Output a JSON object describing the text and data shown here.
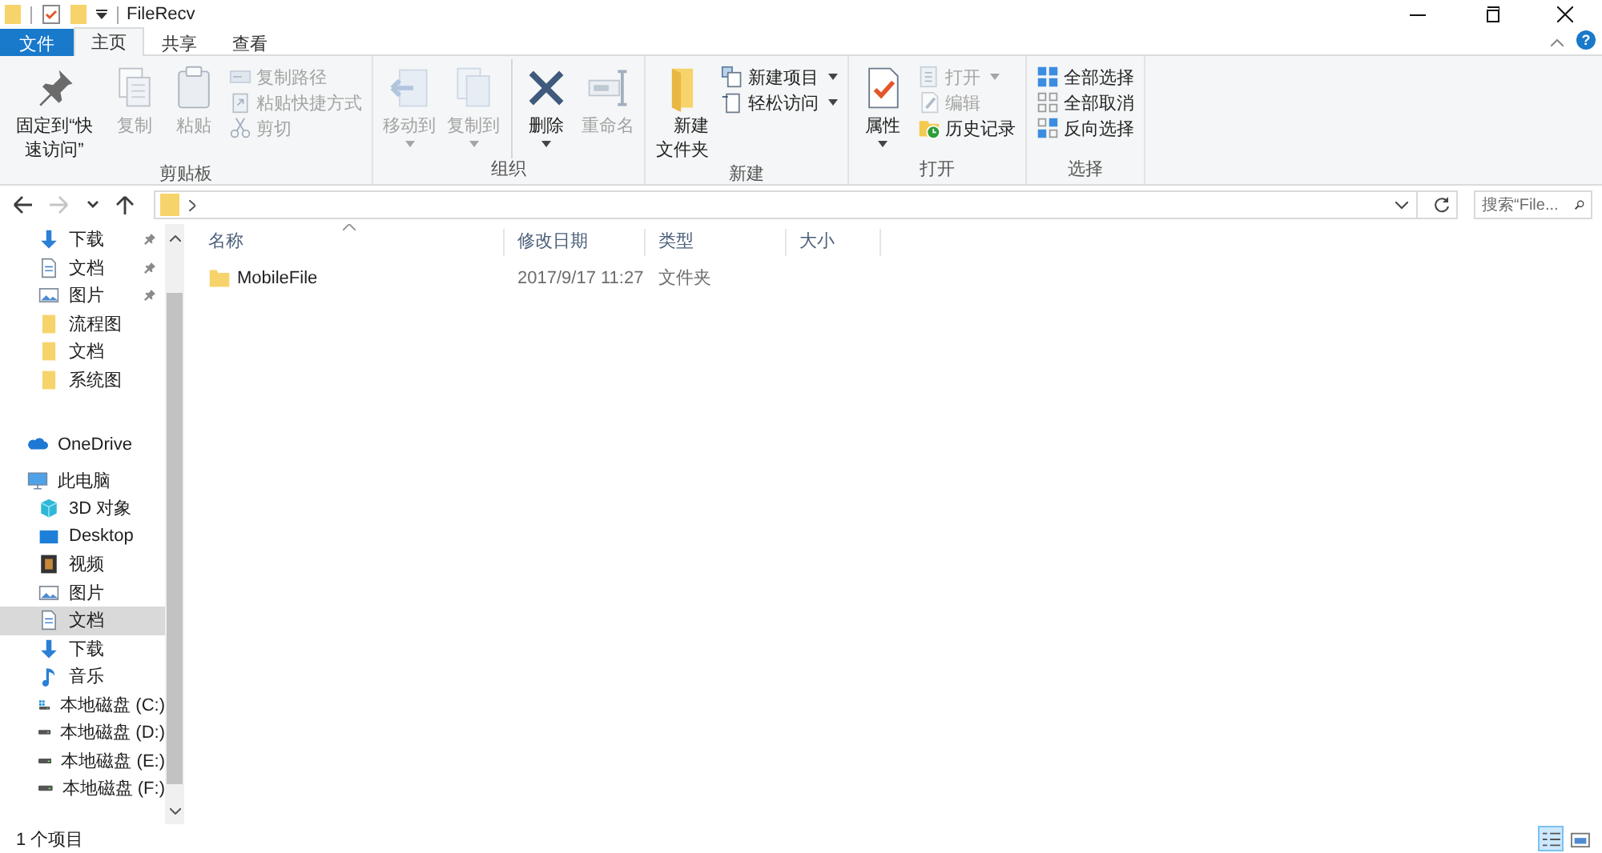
{
  "title_bar": {
    "title": "FileRecv"
  },
  "ribbon": {
    "tabs": [
      {
        "label": "文件",
        "kind": "file",
        "selected": false
      },
      {
        "label": "主页",
        "kind": "tab",
        "selected": true
      },
      {
        "label": "共享",
        "kind": "tab",
        "selected": false
      },
      {
        "label": "查看",
        "kind": "tab",
        "selected": false
      }
    ],
    "help": "?",
    "groups": [
      {
        "label": "剪贴板",
        "buttons": [
          {
            "label": "固定到“快速访问”",
            "kind": "pin",
            "disabled": false,
            "dropdown": false,
            "separator_before": false
          },
          {
            "label": "复制",
            "kind": "copy",
            "disabled": true,
            "dropdown": false,
            "separator_before": false
          },
          {
            "label": "粘贴",
            "kind": "paste",
            "disabled": true,
            "dropdown": false,
            "separator_before": false
          }
        ],
        "menu": [
          {
            "label": "复制路径",
            "kind": "copypath",
            "disabled": true,
            "dropdown": false
          },
          {
            "label": "粘贴快捷方式",
            "kind": "pasteshortcut",
            "disabled": true,
            "dropdown": false
          },
          {
            "label": "剪切",
            "kind": "cut",
            "disabled": true,
            "dropdown": false
          }
        ]
      },
      {
        "label": "组织",
        "buttons": [
          {
            "label": "移动到",
            "kind": "moveto",
            "disabled": true,
            "dropdown": true,
            "separator_before": false
          },
          {
            "label": "复制到",
            "kind": "copyto",
            "disabled": true,
            "dropdown": true,
            "separator_before": false
          },
          {
            "label": "删除",
            "kind": "delete",
            "disabled": false,
            "dropdown": true,
            "separator_before": true
          },
          {
            "label": "重命名",
            "kind": "rename",
            "disabled": true,
            "dropdown": false,
            "separator_before": false
          }
        ]
      },
      {
        "label": "新建",
        "buttons": [
          {
            "label": "新建文件夹",
            "kind": "newfolder",
            "disabled": false,
            "dropdown": false,
            "separator_before": false
          }
        ],
        "menu": [
          {
            "label": "新建项目",
            "kind": "newitem",
            "disabled": false,
            "dropdown": true
          },
          {
            "label": "轻松访问",
            "kind": "easyaccess",
            "disabled": false,
            "dropdown": true
          }
        ]
      },
      {
        "label": "打开",
        "buttons": [
          {
            "label": "属性",
            "kind": "properties",
            "disabled": false,
            "dropdown": true,
            "separator_before": false
          }
        ],
        "menu": [
          {
            "label": "打开",
            "kind": "open",
            "disabled": true,
            "dropdown": true
          },
          {
            "label": "编辑",
            "kind": "edit",
            "disabled": true,
            "dropdown": false
          },
          {
            "label": "历史记录",
            "kind": "history",
            "disabled": false,
            "dropdown": false
          }
        ]
      },
      {
        "label": "选择",
        "menu": [
          {
            "label": "全部选择",
            "kind": "selectall",
            "disabled": false,
            "dropdown": false
          },
          {
            "label": "全部取消",
            "kind": "selectnone",
            "disabled": false,
            "dropdown": false
          },
          {
            "label": "反向选择",
            "kind": "invert",
            "disabled": false,
            "dropdown": false
          }
        ]
      }
    ]
  },
  "address_bar": {
    "nav_buttons": [
      {
        "kind": "back",
        "disabled": false
      },
      {
        "kind": "forward",
        "disabled": true
      },
      {
        "kind": "recent",
        "disabled": false
      },
      {
        "kind": "up",
        "disabled": false
      }
    ],
    "search": {
      "placeholder": "搜索“File..."
    }
  },
  "nav_pane": {
    "quick_access": [
      {
        "label": "下载",
        "kind": "downloads",
        "pinned": true,
        "selected": false
      },
      {
        "label": "文档",
        "kind": "documents",
        "pinned": true,
        "selected": false
      },
      {
        "label": "图片",
        "kind": "pictures",
        "pinned": true,
        "selected": false
      },
      {
        "label": "流程图",
        "kind": "folder",
        "pinned": false,
        "selected": false
      },
      {
        "label": "文档",
        "kind": "folder",
        "pinned": false,
        "selected": false
      },
      {
        "label": "系统图",
        "kind": "folder",
        "pinned": false,
        "selected": false
      }
    ],
    "roots": [
      {
        "label": "OneDrive",
        "kind": "cloud",
        "selected": false
      },
      {
        "label": "此电脑",
        "kind": "pc",
        "selected": false,
        "children": [
          {
            "label": "3D 对象",
            "kind": "objects3d",
            "selected": false
          },
          {
            "label": "Desktop",
            "kind": "desktop",
            "selected": false
          },
          {
            "label": "视频",
            "kind": "videos",
            "selected": false
          },
          {
            "label": "图片",
            "kind": "pictures",
            "selected": false
          },
          {
            "label": "文档",
            "kind": "documents",
            "selected": true
          },
          {
            "label": "下载",
            "kind": "downloads",
            "selected": false
          },
          {
            "label": "音乐",
            "kind": "music",
            "selected": false
          },
          {
            "label": "本地磁盘 (C:)",
            "kind": "systemdrive",
            "selected": false
          },
          {
            "label": "本地磁盘 (D:)",
            "kind": "drive",
            "selected": false
          },
          {
            "label": "本地磁盘 (E:)",
            "kind": "drive",
            "selected": false
          },
          {
            "label": "本地磁盘 (F:)",
            "kind": "drive",
            "selected": false
          }
        ]
      }
    ]
  },
  "file_list": {
    "columns": [
      {
        "label": "名称",
        "sorted": true
      },
      {
        "label": "修改日期",
        "sorted": false
      },
      {
        "label": "类型",
        "sorted": false
      },
      {
        "label": "大小",
        "sorted": false
      }
    ],
    "rows": [
      {
        "name": "MobileFile",
        "kind": "folder",
        "modified": "2017/9/17 11:27",
        "type": "文件夹",
        "selected": false
      }
    ]
  },
  "status_bar": {
    "item_count": "1 个项目",
    "views": [
      {
        "kind": "details",
        "selected": true
      },
      {
        "kind": "tiles",
        "selected": false
      }
    ]
  }
}
